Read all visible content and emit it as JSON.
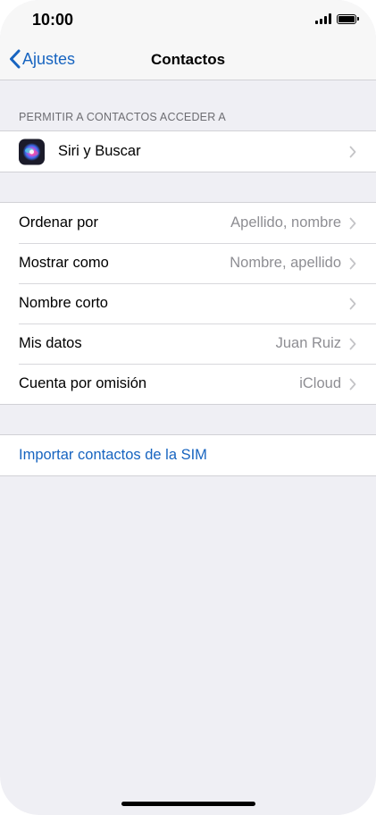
{
  "status_bar": {
    "time": "10:00",
    "signal_icon": "signal-bars-icon",
    "battery_icon": "battery-icon"
  },
  "nav": {
    "back_label": "Ajustes",
    "title": "Contactos"
  },
  "section_access": {
    "header": "PERMITIR A CONTACTOS ACCEDER A",
    "items": [
      {
        "label": "Siri y Buscar",
        "icon": "siri-icon"
      }
    ]
  },
  "settings": {
    "items": [
      {
        "label": "Ordenar por",
        "value": "Apellido, nombre"
      },
      {
        "label": "Mostrar como",
        "value": "Nombre, apellido"
      },
      {
        "label": "Nombre corto",
        "value": ""
      },
      {
        "label": "Mis datos",
        "value": "Juan Ruiz"
      },
      {
        "label": "Cuenta por omisión",
        "value": "iCloud"
      }
    ]
  },
  "sim": {
    "import_label": "Importar contactos de la SIM"
  },
  "colors": {
    "accent": "#1764c0",
    "background": "#efeff4",
    "secondary_text": "#8e8e93"
  }
}
